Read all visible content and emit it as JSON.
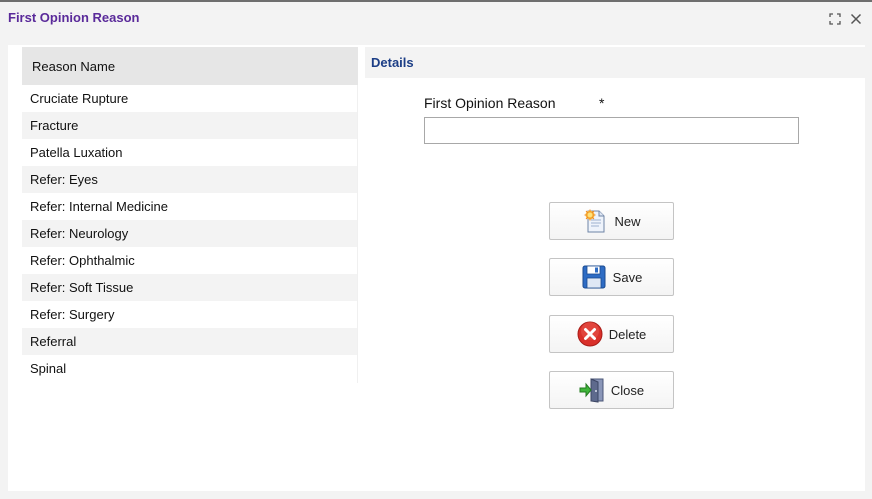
{
  "window": {
    "title": "First Opinion Reason"
  },
  "list": {
    "header": "Reason Name",
    "items": [
      "Cruciate Rupture",
      "Fracture",
      "Patella Luxation",
      "Refer: Eyes",
      "Refer: Internal Medicine",
      "Refer: Neurology",
      "Refer: Ophthalmic",
      "Refer: Soft Tissue",
      "Refer: Surgery",
      "Referral",
      "Spinal"
    ]
  },
  "details": {
    "tab_label": "Details",
    "field_label": "First Opinion Reason",
    "required_marker": "*",
    "field_value": ""
  },
  "buttons": {
    "new": "New",
    "save": "Save",
    "delete": "Delete",
    "close": "Close"
  },
  "icons": {
    "maximize": "maximize-icon",
    "close": "close-icon",
    "new": "new-document-icon",
    "save": "floppy-disk-icon",
    "delete": "red-x-icon",
    "close_door": "exit-door-icon"
  },
  "colors": {
    "title": "#5a2a9a",
    "details_label": "#1c3e86",
    "delete_red": "#d9302a"
  }
}
